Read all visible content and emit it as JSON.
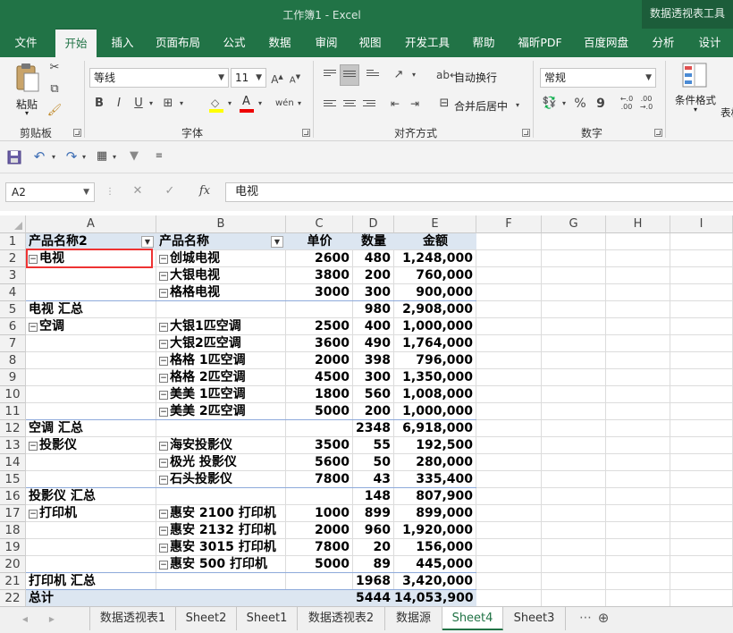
{
  "window": {
    "title": "工作簿1  -  Excel",
    "context_tab": "数据透视表工具"
  },
  "tabs": [
    "文件",
    "开始",
    "插入",
    "页面布局",
    "公式",
    "数据",
    "审阅",
    "视图",
    "开发工具",
    "帮助",
    "福昕PDF",
    "百度网盘",
    "分析",
    "设计"
  ],
  "ribbon": {
    "paste": "粘贴",
    "clipboard_label": "剪贴板",
    "font_name": "等线",
    "font_size": "11",
    "font_label": "字体",
    "bold": "B",
    "italic": "I",
    "underline": "U",
    "wrap_text": "自动换行",
    "merge_center": "合并后居中",
    "align_label": "对齐方式",
    "number_format": "常规",
    "percent": "%",
    "comma": "9",
    "number_label": "数字",
    "cond_format": "条件格式",
    "table_format": "表格"
  },
  "formula_bar": {
    "name_box": "A2",
    "fx": "fx",
    "content": "电视"
  },
  "columns": [
    "A",
    "B",
    "C",
    "D",
    "E",
    "F",
    "G",
    "H",
    "I"
  ],
  "rows": [
    "1",
    "2",
    "3",
    "4",
    "5",
    "6",
    "7",
    "8",
    "9",
    "10",
    "11",
    "12",
    "13",
    "14",
    "15",
    "16",
    "17",
    "18",
    "19",
    "20",
    "21",
    "22"
  ],
  "table": {
    "headers": [
      "产品名称2",
      "产品名称",
      "单价",
      "数量",
      "金额"
    ],
    "cells": [
      [
        "电视",
        "创城电视",
        "2600",
        "480",
        "1,248,000"
      ],
      [
        "",
        "大银电视",
        "3800",
        "200",
        "760,000"
      ],
      [
        "",
        "格格电视",
        "3000",
        "300",
        "900,000"
      ],
      [
        "电视 汇总",
        "",
        "",
        "980",
        "2,908,000"
      ],
      [
        "空调",
        "大银1匹空调",
        "2500",
        "400",
        "1,000,000"
      ],
      [
        "",
        "大银2匹空调",
        "3600",
        "490",
        "1,764,000"
      ],
      [
        "",
        "格格 1匹空调",
        "2000",
        "398",
        "796,000"
      ],
      [
        "",
        "格格 2匹空调",
        "4500",
        "300",
        "1,350,000"
      ],
      [
        "",
        "美美 1匹空调",
        "1800",
        "560",
        "1,008,000"
      ],
      [
        "",
        "美美 2匹空调",
        "5000",
        "200",
        "1,000,000"
      ],
      [
        "空调 汇总",
        "",
        "",
        "2348",
        "6,918,000"
      ],
      [
        "投影仪",
        "海安投影仪",
        "3500",
        "55",
        "192,500"
      ],
      [
        "",
        "极光 投影仪",
        "5600",
        "50",
        "280,000"
      ],
      [
        "",
        "石头投影仪",
        "7800",
        "43",
        "335,400"
      ],
      [
        "投影仪 汇总",
        "",
        "",
        "148",
        "807,900"
      ],
      [
        "打印机",
        "惠安 2100 打印机",
        "1000",
        "899",
        "899,000"
      ],
      [
        "",
        "惠安 2132 打印机",
        "2000",
        "960",
        "1,920,000"
      ],
      [
        "",
        "惠安 3015 打印机",
        "7800",
        "20",
        "156,000"
      ],
      [
        "",
        "惠安 500 打印机",
        "5000",
        "89",
        "445,000"
      ],
      [
        "打印机 汇总",
        "",
        "",
        "1968",
        "3,420,000"
      ],
      [
        "总计",
        "",
        "",
        "5444",
        "14,053,900"
      ]
    ]
  },
  "sheets": [
    "数据透视表1",
    "Sheet2",
    "Sheet1",
    "数据透视表2",
    "数据源",
    "Sheet4",
    "Sheet3"
  ],
  "active_sheet": "Sheet4",
  "colors": {
    "accent": "#217346",
    "pivot_header": "#dce6f1",
    "selection": "#ee3333"
  }
}
